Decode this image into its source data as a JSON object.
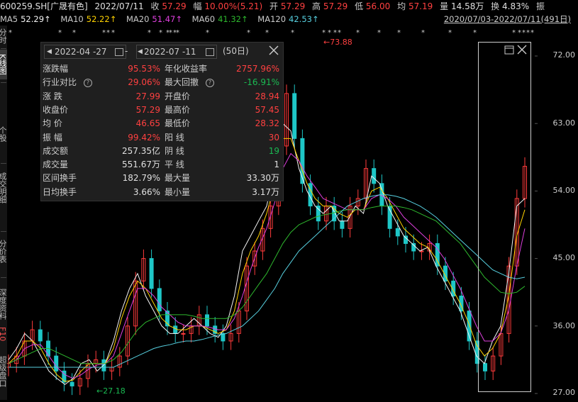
{
  "header": {
    "code": "600259.SH[广晟有色]",
    "date": "2022/07/11",
    "close_label": "收",
    "close": "57.29",
    "chg_label": "幅",
    "chg": "10.00%(5.21)",
    "open_label": "开",
    "open": "57.29",
    "high_label": "高",
    "high": "57.29",
    "low_label": "低",
    "low": "56.00",
    "avg_label": "均",
    "avg": "57.19",
    "vol_label": "量",
    "vol": "14.58万",
    "turnover_label": "换",
    "turnover": "4.83%",
    "amp_label": "振"
  },
  "ma": {
    "ma5_label": "MA5",
    "ma5": "52.29↑",
    "ma10_label": "MA10",
    "ma10": "52.22↑",
    "ma20_label": "MA20",
    "ma20": "51.47↑",
    "ma60_label": "MA60",
    "ma60": "41.32↑",
    "ma120_label": "MA120",
    "ma120": "42.53↑",
    "range": "2020/07/03-2022/07/11(491日)"
  },
  "colors": {
    "ma5": "#f5f5f5",
    "ma10": "#ffd200",
    "ma20": "#e040e0",
    "ma60": "#2eb82e",
    "ma120": "#57d0e0",
    "up": "#ff3b3b",
    "down": "#1ec7c7"
  },
  "sidebar": {
    "tabs": [
      "分时图",
      "K线图",
      "个股",
      "成交明细",
      "分价表",
      "深度资料",
      "F10",
      "超级盘口"
    ]
  },
  "panel": {
    "start_date": "2022-04 -27",
    "sep": "-",
    "end_date": "2022-07 -11",
    "days": "(50日)",
    "rows": [
      {
        "k1": "涨跌幅",
        "v1": "95.53%",
        "c1": "red",
        "k2": "年化收益率",
        "v2": "2757.96%",
        "c2": "red"
      },
      {
        "k1": "行业对比",
        "v1": "29.06%",
        "c1": "red",
        "k2": "最大回撤",
        "v2": "-16.91%",
        "c2": "green"
      },
      {
        "k1": "涨  跌",
        "v1": "27.99",
        "c1": "red",
        "k2": "开盘价",
        "v2": "28.94",
        "c2": "red"
      },
      {
        "k1": "收盘价",
        "v1": "57.29",
        "c1": "red",
        "k2": "最高价",
        "v2": "57.45",
        "c2": "red"
      },
      {
        "k1": "均  价",
        "v1": "46.65",
        "c1": "red",
        "k2": "最低价",
        "v2": "28.32",
        "c2": "red"
      },
      {
        "k1": "振  幅",
        "v1": "99.42%",
        "c1": "red",
        "k2": "阳  线",
        "v2": "30",
        "c2": "red"
      },
      {
        "k1": "成交额",
        "v1": "257.35亿",
        "c1": "white",
        "k2": "阴  线",
        "v2": "19",
        "c2": "green"
      },
      {
        "k1": "成交量",
        "v1": "551.67万",
        "c1": "white",
        "k2": "平  线",
        "v2": "1",
        "c2": "white"
      },
      {
        "k1": "区间换手",
        "v1": "182.79%",
        "c1": "white",
        "k2": "最大量",
        "v2": "33.30万",
        "c2": "white"
      },
      {
        "k1": "日均换手",
        "v1": "3.66%",
        "c1": "white",
        "k2": "最小量",
        "v2": "3.17万",
        "c2": "white"
      }
    ]
  },
  "chart_data": {
    "type": "candlestick",
    "y_ticks": [
      "72.00",
      "63.00",
      "54.00",
      "45.00",
      "36.00",
      "27.00"
    ],
    "ylim": [
      27,
      72
    ],
    "annotations": [
      {
        "label": "73.88",
        "kind": "high"
      },
      {
        "label": "27.18",
        "kind": "low"
      }
    ],
    "ma_series": {
      "ma5": [
        31.5,
        33,
        35,
        34,
        32,
        30,
        29,
        28.2,
        29,
        31,
        31.5,
        30,
        31,
        34,
        38,
        41,
        43,
        40,
        38,
        36,
        35,
        35,
        36,
        37,
        36,
        35,
        34.5,
        36,
        40,
        46,
        48,
        50,
        52,
        57,
        63,
        62,
        57,
        54,
        52,
        51,
        52,
        50,
        50,
        52,
        51,
        56,
        55,
        52,
        50,
        48,
        47,
        46,
        46.5,
        44,
        42,
        40,
        38,
        35,
        32,
        31,
        34,
        36,
        43,
        52,
        53
      ],
      "ma10": [
        31,
        32,
        34,
        34,
        33,
        31,
        29.5,
        28.6,
        28.8,
        30,
        31,
        31,
        31,
        33,
        37,
        40,
        42,
        41,
        39,
        37,
        36,
        35.5,
        35.5,
        36,
        36,
        35.5,
        35,
        35.5,
        38,
        43,
        46,
        48,
        51,
        55,
        61,
        61,
        58,
        55,
        53,
        52,
        52,
        51,
        50.5,
        51.5,
        51.5,
        54,
        54.5,
        53,
        51,
        49,
        48,
        47,
        46.5,
        45,
        43,
        41,
        39,
        36.5,
        33.5,
        32,
        33,
        35,
        40,
        48,
        51.5
      ],
      "ma20": [
        31,
        31.5,
        33,
        33.5,
        33.5,
        32,
        30.5,
        29.5,
        29,
        29.5,
        30.3,
        30.8,
        31,
        32,
        35,
        38,
        41,
        41,
        40,
        38.5,
        37.5,
        36.5,
        36,
        36,
        36,
        35.8,
        35.5,
        35.5,
        37,
        40,
        43.5,
        46.5,
        49,
        52.5,
        57,
        59,
        58,
        56,
        54.5,
        53,
        52.5,
        52,
        51.5,
        51.5,
        51.5,
        53,
        53.5,
        53,
        52,
        50.5,
        49.5,
        48.5,
        47.5,
        46.5,
        45,
        43,
        41,
        38.5,
        36,
        34,
        34,
        35,
        38,
        44,
        49
      ],
      "ma60": [
        31,
        31.5,
        32,
        32.5,
        33,
        33,
        32.5,
        32,
        31.5,
        31,
        31,
        31,
        31,
        31.5,
        32.5,
        34,
        35.5,
        36.5,
        37,
        37.5,
        37.5,
        37.5,
        37.5,
        37.3,
        37,
        37,
        37,
        37,
        37.5,
        38.5,
        40,
        41.5,
        43,
        45,
        47,
        48.5,
        49.5,
        50,
        50.5,
        50.8,
        51,
        51.3,
        51.5,
        51.5,
        51.5,
        51.8,
        52,
        52,
        52,
        51.8,
        51.5,
        51,
        50.5,
        50,
        49,
        48,
        47,
        45.5,
        44,
        42.5,
        41.5,
        40.5,
        40.3,
        40.5,
        41.3
      ],
      "ma120": [
        30.5,
        30.5,
        30.5,
        30.5,
        30.5,
        30.5,
        30.5,
        30.5,
        30.5,
        30.5,
        30.5,
        30.5,
        30.5,
        30.5,
        31,
        31.5,
        32,
        32.5,
        33,
        33.3,
        33.5,
        33.8,
        34,
        34,
        34.2,
        34.5,
        34.8,
        35,
        35.5,
        36,
        37,
        38,
        39.5,
        41,
        43,
        44.5,
        46,
        47,
        48,
        49,
        50,
        51,
        52,
        52.5,
        53,
        53.3,
        53.5,
        53.5,
        53.3,
        53,
        52.5,
        52,
        51.3,
        50.5,
        49.5,
        48.5,
        47.5,
        46.5,
        45.5,
        44.5,
        43.5,
        43,
        42.5,
        42.3,
        42.5
      ]
    },
    "candles_close": [
      31,
      32,
      34,
      35.5,
      34,
      32,
      30,
      28.5,
      28,
      29,
      31,
      31.5,
      30,
      30.5,
      32,
      36,
      42,
      45,
      41,
      38,
      36,
      35,
      35,
      36,
      37.5,
      36,
      35,
      34,
      35,
      38,
      44,
      46,
      49,
      52,
      60,
      67,
      61,
      55,
      52,
      50,
      52,
      50,
      49,
      52,
      53,
      57,
      55,
      52,
      49,
      48,
      47,
      46,
      46,
      47,
      44,
      42,
      40,
      38,
      34,
      31,
      30,
      32,
      35,
      44,
      53,
      57.29
    ]
  }
}
